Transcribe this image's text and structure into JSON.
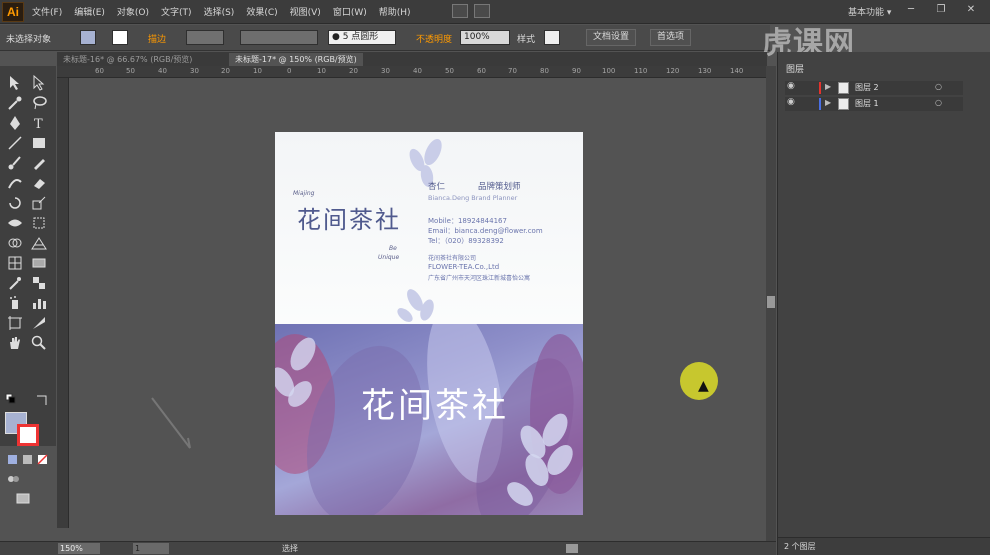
{
  "app": {
    "logo": "Ai",
    "workspace": "基本功能 ▾",
    "window_buttons": [
      "─",
      "❐",
      "✕"
    ],
    "watermark": "虎课网"
  },
  "menu": [
    "文件(F)",
    "编辑(E)",
    "对象(O)",
    "文字(T)",
    "选择(S)",
    "效果(C)",
    "视图(V)",
    "窗口(W)",
    "帮助(H)"
  ],
  "control_bar": {
    "selection": "未选择对象",
    "stroke_label": "描边",
    "brush_value": "● 5 点圆形",
    "opacity_label": "不透明度",
    "opacity_value": "100%",
    "style_label": "样式",
    "doc_setup": "文档设置",
    "prefs": "首选项"
  },
  "tabs": [
    {
      "label": "未标题-16* @ 66.67% (RGB/预览)",
      "active": false
    },
    {
      "label": "未标题-17* @ 150% (RGB/预览)",
      "active": true
    }
  ],
  "ruler_h": [
    "60",
    "50",
    "40",
    "30",
    "20",
    "10",
    "0",
    "10",
    "20",
    "30",
    "40",
    "50",
    "60",
    "70",
    "80",
    "90",
    "100",
    "110",
    "120",
    "130",
    "140"
  ],
  "status": {
    "zoom": "150%",
    "page": "1",
    "mode": "选择"
  },
  "layers_panel": {
    "title": "图层",
    "layers": [
      {
        "name": "图层 2",
        "color": "#e3332d",
        "target": "○"
      },
      {
        "name": "图层 1",
        "color": "#4a6fe3",
        "target": "○"
      }
    ],
    "count": "2 个图层"
  },
  "card": {
    "brand": "花间茶社",
    "brand_en_1": "Miajing",
    "brand_en_2": "Be",
    "brand_en_3": "Unique",
    "person_name": "杏仁",
    "person_title": "品牌策划师",
    "person_en": "Bianca.Deng   Brand Planner",
    "mobile": "Mobile：18924844167",
    "email": "Email：bianca.deng@flower.com",
    "tel": "Tel：（020）89328392",
    "company": "花间茶社有限公司",
    "company_en": "FLOWER-TEA.Co.,Ltd",
    "address": "广东省广州市天河区珠江新城喜怡公寓"
  },
  "colors": {
    "accent": "#ff9a00",
    "card_brand": "#505a8e",
    "cursor_highlight": "#dcdc28"
  }
}
